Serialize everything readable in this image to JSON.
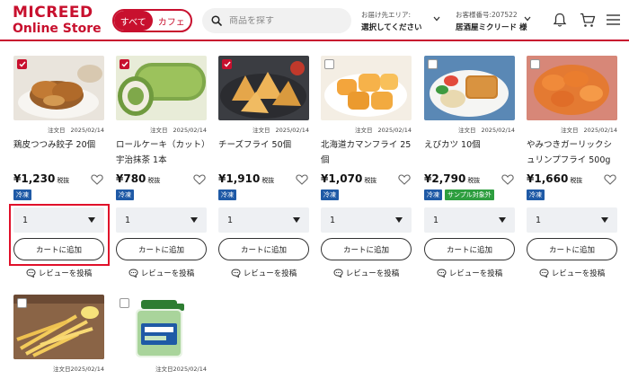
{
  "brand": {
    "line1": "MICREED",
    "line2": "Online Store"
  },
  "toggle": {
    "all": "すべて",
    "cafe": "カフェ"
  },
  "search": {
    "placeholder": "商品を探す"
  },
  "delivery": {
    "label": "お届け先エリア:",
    "value": "選択してください"
  },
  "customer": {
    "label": "お客様番号:207522",
    "name": "居酒屋ミクリード 様"
  },
  "colors": {
    "accent": "#c8102e",
    "frozen": "#1f5aa6",
    "sample": "#2e9e3f"
  },
  "common": {
    "order_label": "注文日",
    "tax_label": "税抜",
    "cart_label": "カートに追加",
    "review_label": "レビューを投稿"
  },
  "products": [
    {
      "checked": true,
      "date": "2025/02/14",
      "name": "鶏皮つつみ餃子 20個",
      "price": "¥1,230",
      "badges": [
        "冷凍"
      ],
      "qty": "1",
      "image": "fried-dumplings"
    },
    {
      "checked": true,
      "date": "2025/02/14",
      "name": "ロールケーキ（カット）宇治抹茶 1本",
      "price": "¥780",
      "badges": [
        "冷凍"
      ],
      "qty": "1",
      "image": "matcha-roll-cake"
    },
    {
      "checked": true,
      "date": "2025/02/14",
      "name": "チーズフライ 50個",
      "price": "¥1,910",
      "badges": [
        "冷凍"
      ],
      "qty": "1",
      "image": "cheese-fries"
    },
    {
      "checked": false,
      "date": "2025/02/14",
      "name": "北海道カマンフライ 25個",
      "price": "¥1,070",
      "badges": [
        "冷凍"
      ],
      "qty": "1",
      "image": "camembert-fries"
    },
    {
      "checked": false,
      "date": "2025/02/14",
      "name": "えびカツ 10個",
      "price": "¥2,790",
      "badges": [
        "冷凍",
        "サンプル対象外"
      ],
      "qty": "1",
      "image": "shrimp-cutlet"
    },
    {
      "checked": false,
      "date": "2025/02/14",
      "name": "やみつきガーリックシュリンプフライ 500g",
      "price": "¥1,660",
      "badges": [
        "冷凍"
      ],
      "qty": "1",
      "image": "garlic-shrimp"
    },
    {
      "checked": false,
      "date": "2025/02/14",
      "image": "french-fries"
    },
    {
      "checked": false,
      "date": "2025/02/14",
      "image": "detergent-bottle"
    }
  ]
}
